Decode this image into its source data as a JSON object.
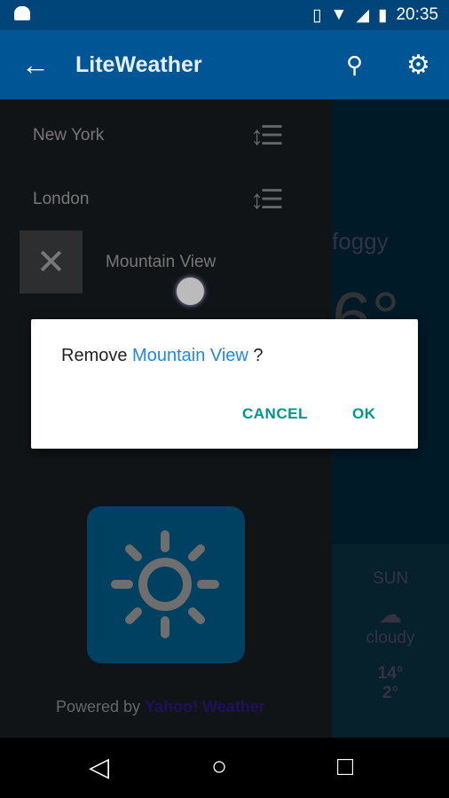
{
  "status": {
    "time": "20:35",
    "icons": [
      "android-icon",
      "vibrate-icon",
      "wifi-icon",
      "signal-icon",
      "battery-charging-icon"
    ]
  },
  "appbar": {
    "title": "LiteWeather",
    "icons": [
      "back-arrow-icon",
      "search-icon",
      "gear-icon"
    ]
  },
  "drawer": {
    "cities": [
      "New York",
      "London",
      "Mountain View"
    ],
    "powered_by": "Powered by",
    "provider": "Yahoo! Weather"
  },
  "main": {
    "condition": "foggy",
    "temp": "6°",
    "forecast": {
      "day": "SUN",
      "condition": "cloudy",
      "high": "14°",
      "low": "2°"
    }
  },
  "dialog": {
    "prefix": "Remove",
    "city": "Mountain View",
    "suffix": " ?",
    "cancel": "CANCEL",
    "ok": "OK"
  },
  "colors": {
    "appbar": "#005694",
    "accent": "#009688",
    "link": "#1e88e5"
  }
}
